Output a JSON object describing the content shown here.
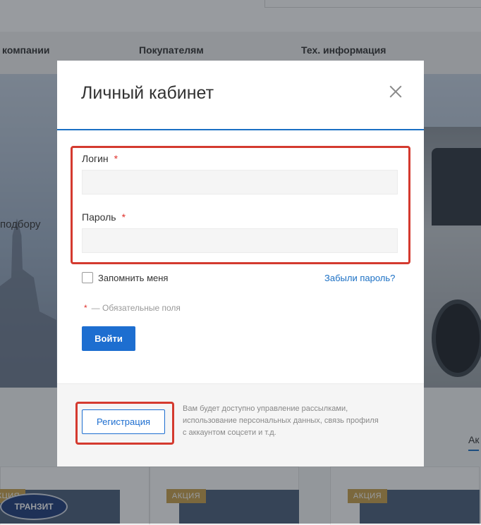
{
  "background": {
    "nav": [
      "компании",
      "Покупателям",
      "Тех. информация"
    ],
    "side_text": "подбору",
    "badge_label": "АКЦИЯ",
    "logo_text": "ТРАНЗИТ",
    "tab_label": "Ак"
  },
  "modal": {
    "title": "Личный кабинет",
    "close_icon": "close-icon",
    "login_label": "Логин",
    "password_label": "Пароль",
    "required_mark": "*",
    "login_value": "",
    "password_value": "",
    "remember_label": "Запомнить меня",
    "forgot_link": "Забыли пароль?",
    "required_note": "— Обязательные поля",
    "submit_label": "Войти",
    "register_label": "Регистрация",
    "register_note": "Вам будет доступно управление рассылками, использование персональных данных, связь профиля с аккаунтом соцсети и т.д."
  },
  "colors": {
    "accent": "#1d6ed0",
    "highlight": "#d43a2f",
    "required": "#e0312b"
  }
}
